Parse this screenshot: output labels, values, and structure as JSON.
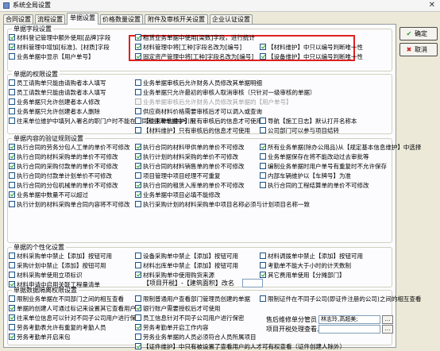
{
  "window": {
    "title": "系统全局设置",
    "close_glyph": "✕"
  },
  "tabs": [
    "合同设置",
    "流程设置",
    "单据设置",
    "价格数量设置",
    "附件及审核开关设置",
    "企业认证设置"
  ],
  "active_tab": "单据设置",
  "buttons": {
    "confirm": {
      "glyph": "✔",
      "label": "确定",
      "color": "#2a9d2a"
    },
    "cancel": {
      "glyph": "✖",
      "label": "取消",
      "color": "#cc2222"
    }
  },
  "groups": {
    "g1": "单据字段设置",
    "g2": "单据的权限设置",
    "g3": "单据内容的验证规则设置",
    "g4": "单据的个性化设置",
    "g5": "单据数据隔离权限设置"
  },
  "checkboxes": [
    {
      "label": "材料登记管理中额外使用[品牌]字段",
      "checked": true,
      "disabled": false
    },
    {
      "label": "租赁业务单据中使用[梁数]字段，进行统计",
      "checked": true,
      "disabled": false
    },
    {
      "label": "材料管理中增加[标准]、[材质]字段",
      "checked": true,
      "disabled": false
    },
    {
      "label": "材料管理中将[工种]字段名改为[编号]",
      "checked": true,
      "disabled": false
    },
    {
      "label": "【材料维护】中只以编号判断唯一性",
      "checked": true,
      "disabled": false
    },
    {
      "label": "业务单据中显示【用户单号】",
      "checked": false,
      "disabled": false
    },
    {
      "label": "固定资产管理中将[工种]字段名改为[编号]",
      "checked": true,
      "disabled": false
    },
    {
      "label": "【设备维护】中只以编号判断唯一性",
      "checked": true,
      "disabled": false
    },
    {
      "label": "员工请购单只能由请购者本人填写",
      "checked": false,
      "disabled": false
    },
    {
      "label": "业务单据审核后允许财务人员修改其单据明细",
      "checked": false,
      "disabled": false
    },
    {
      "label": "员工请款单只能由请款者本人填写",
      "checked": false,
      "disabled": false
    },
    {
      "label": "业务单据只允许最初的审核人取消审核（只针对一级审核的单据）",
      "checked": false,
      "disabled": false
    },
    {
      "label": "业务单据只允许创建者本人修改",
      "checked": false,
      "disabled": false
    },
    {
      "label": "业务单据审核后允许财务人员修改其单据的【用户单号】",
      "checked": false,
      "disabled": true
    },
    {
      "label": "业务单据只允许创建者本人删除",
      "checked": false,
      "disabled": false
    },
    {
      "label": "供应商材料价格需要审核后才可以调入或查询",
      "checked": false,
      "disabled": false
    },
    {
      "label": "往来单位维护中填列入署名的职门户时不能在合同和往来单据中引用",
      "checked": false,
      "disabled": false
    },
    {
      "label": "【往来单位维护】只有审核后的信息才可使用",
      "checked": false,
      "disabled": false
    },
    {
      "label": "【材料维护】只有审核后的信息才可使用",
      "checked": false,
      "disabled": false
    },
    {
      "label": "导航【施工日志】默认打开名称本",
      "checked": false,
      "disabled": false
    },
    {
      "label": "公司部门可以参与项目结转",
      "checked": false,
      "disabled": false
    },
    {
      "label": "执行合同的劳务分包人工单的单价不可修改",
      "checked": true,
      "disabled": false
    },
    {
      "label": "执行合同的材料甲供单的单价不可修改",
      "checked": true,
      "disabled": false
    },
    {
      "label": "所有业务单据(除办公用品)从【规定基本信息维护】中选择",
      "checked": true,
      "disabled": false
    },
    {
      "label": "执行合同的材料采购单的单价不可修改",
      "checked": true,
      "disabled": false
    },
    {
      "label": "执行计划的材料采购的单价不可修改",
      "checked": true,
      "disabled": false
    },
    {
      "label": "业务单据保存在将不能改动过去审批等",
      "checked": false,
      "disabled": false
    },
    {
      "label": "执行合同的采购付款单的单价不可修改",
      "checked": true,
      "disabled": false
    },
    {
      "label": "执行合同的材料销售单的单价不可修改",
      "checked": true,
      "disabled": false
    },
    {
      "label": "编制业务单据时用户单号有重复时不允许保存",
      "checked": false,
      "disabled": false
    },
    {
      "label": "执行合同的付款单计划单价不可修改",
      "checked": false,
      "disabled": false
    },
    {
      "label": "项目管理中项目经理不可重复",
      "checked": false,
      "disabled": false
    },
    {
      "label": "内部车辆维护以【车牌号】为准",
      "checked": false,
      "disabled": false
    },
    {
      "label": "执行合同的分包机械单的单价不可修改",
      "checked": false,
      "disabled": false
    },
    {
      "label": "执行合同的租赁入库单的单价不可修改",
      "checked": true,
      "disabled": false
    },
    {
      "label": "执行合同的工程结算单的单价不可修改",
      "checked": false,
      "disabled": false
    },
    {
      "label": "业务单据中数量不可以超过",
      "checked": true,
      "disabled": false
    },
    {
      "label": "业务单据中项目必填不能修改",
      "checked": true,
      "disabled": false
    },
    {
      "label": "执行计划的材料采购单合同内容将不可修改",
      "checked": false,
      "disabled": false
    },
    {
      "label": "执行采购计划的材料采购单中项目名称必须与计划项目名称一致",
      "checked": false,
      "disabled": false
    },
    {
      "label": "材料采购单中禁止【添加】按钮可用",
      "checked": false,
      "disabled": false
    },
    {
      "label": "设备采购单中禁止【添加】按钮可用",
      "checked": false,
      "disabled": false
    },
    {
      "label": "材料调拨单中禁止【添加】按钮可用",
      "checked": false,
      "disabled": false
    },
    {
      "label": "采购计划中禁止【添加】按钮可用",
      "checked": false,
      "disabled": false
    },
    {
      "label": "材料出库单中禁止【添加】按钮可用",
      "checked": false,
      "disabled": false
    },
    {
      "label": "考勤单不能大于小时的计天数制",
      "checked": false,
      "disabled": false
    },
    {
      "label": "材料采购单使用立项标识",
      "checked": false,
      "disabled": false
    },
    {
      "label": "材料采购单中使用购货来源",
      "checked": true,
      "disabled": false
    },
    {
      "label": "其它费用单使用【分摊部门】",
      "checked": true,
      "disabled": false
    },
    {
      "label": "材料申请中启用关联工程量清单",
      "checked": true,
      "disabled": false
    },
    {
      "label": "限制业务单据在不同部门之间的相互查看",
      "checked": false,
      "disabled": false
    },
    {
      "label": "限制普通用户查看部门管理员创建的单据",
      "checked": false,
      "disabled": false
    },
    {
      "label": "限制证件在不同子公司(即证件注册的公司)之间的相互查看",
      "checked": false,
      "disabled": false
    },
    {
      "label": "单据的创建人可通过标记来设置其它查看用户",
      "checked": true,
      "disabled": false
    },
    {
      "label": "银行账户需要授权后才可使用",
      "checked": true,
      "disabled": false
    },
    {
      "label": "往来单位信息可以针对不同子公司用户进行保密",
      "checked": true,
      "disabled": false
    },
    {
      "label": "员工信息针对不同子公司用户进行保密",
      "checked": false,
      "disabled": false
    },
    {
      "label": "劳务考勤表允许有重复的考勤人员",
      "checked": false,
      "disabled": false
    },
    {
      "label": "劳务考勤单开启工作内容",
      "checked": true,
      "disabled": false
    },
    {
      "label": "劳务业务单据的人员必须符合人员所属项目",
      "checked": false,
      "disabled": false
    },
    {
      "label": "劳务考勤单开启来包",
      "checked": true,
      "disabled": false
    },
    {
      "label": "【证件维护】中只有被设置了查看用户的人才可有权查看（证件创建人除外）",
      "checked": true,
      "disabled": false
    }
  ],
  "extras": {
    "project_tax": "【项目开税】-【建筑面积】改名",
    "approver_label": "售后维修单分管员",
    "approver_value": "林志玲,高超美;",
    "project_handler": "项目开税处理查看人"
  }
}
